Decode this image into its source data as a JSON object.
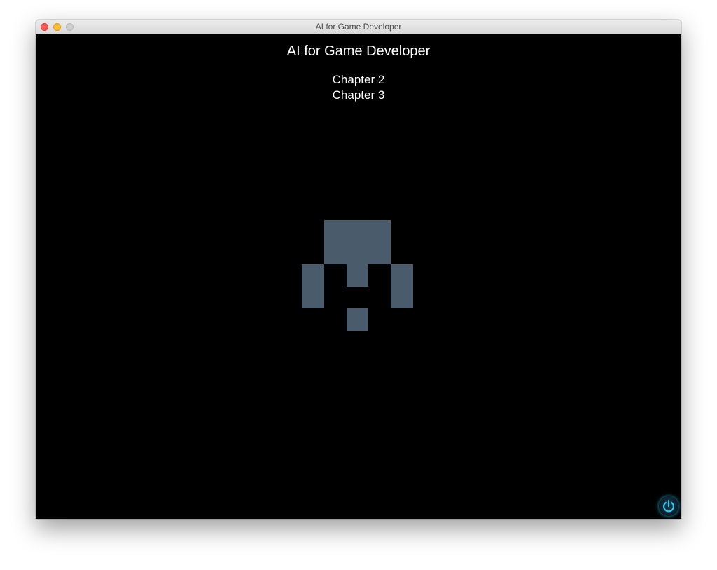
{
  "window": {
    "title": "AI for Game Developer"
  },
  "game": {
    "title": "AI for Game Developer",
    "menu": [
      {
        "label": "Chapter 2"
      },
      {
        "label": "Chapter 3"
      }
    ]
  },
  "colors": {
    "background": "#000000",
    "sprite": "#4a5b6c",
    "power_glow": "#2cbee6"
  },
  "icons": {
    "power": "power-icon"
  }
}
